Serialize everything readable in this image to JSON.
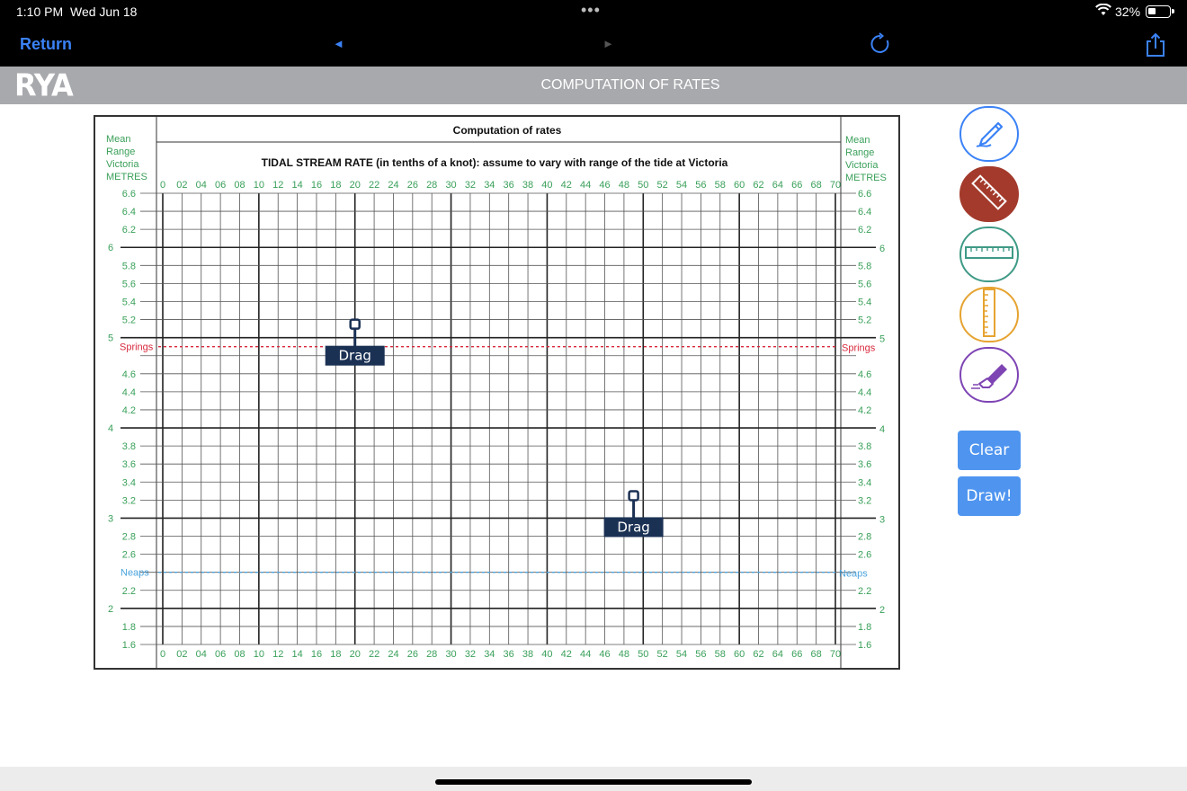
{
  "status_bar": {
    "time": "1:10 PM",
    "date": "Wed Jun 18",
    "multitask_dots": "•••",
    "battery_percent": "32%",
    "battery_level": 0.32
  },
  "nav": {
    "return_label": "Return",
    "back_arrow": "◄",
    "forward_arrow": "►",
    "reload_icon": "reload-icon",
    "share_icon": "share-icon"
  },
  "header": {
    "logo": "RYA",
    "title": "COMPUTATION OF RATES"
  },
  "chart": {
    "title": "Computation of rates",
    "subtitle": "TIDAL STREAM RATE (in tenths of a knot): assume to vary with range of the tide at Victoria",
    "side_label_lines": [
      "Mean",
      "Range",
      "Victoria",
      "METRES"
    ],
    "x_ticks": [
      "0",
      "02",
      "04",
      "06",
      "08",
      "10",
      "12",
      "14",
      "16",
      "18",
      "20",
      "22",
      "24",
      "26",
      "28",
      "30",
      "32",
      "34",
      "36",
      "38",
      "40",
      "42",
      "44",
      "46",
      "48",
      "50",
      "52",
      "54",
      "56",
      "58",
      "60",
      "62",
      "64",
      "66",
      "68",
      "70"
    ],
    "y_ticks": [
      "6.6",
      "6.4",
      "6.2",
      "6",
      "5.8",
      "5.6",
      "5.4",
      "5.2",
      "5",
      "4.8",
      "4.6",
      "4.4",
      "4.2",
      "4",
      "3.8",
      "3.6",
      "3.4",
      "3.2",
      "3",
      "2.8",
      "2.6",
      "2.4",
      "2.2",
      "2",
      "1.8",
      "1.6"
    ],
    "y_integer_ticks": [
      "6",
      "5",
      "4",
      "3",
      "2"
    ],
    "springs_label": "Springs",
    "springs_value": 4.9,
    "neaps_label": "Neaps",
    "neaps_value": 2.4,
    "springs_color": "#d8283c",
    "neaps_color": "#4aa3dd",
    "tick_color": "#3aa05a",
    "handles": [
      {
        "label": "Drag",
        "x_value": 20,
        "y_value": 4.9
      },
      {
        "label": "Drag",
        "x_value": 49,
        "y_value": 3.0
      }
    ]
  },
  "tools": {
    "pencil_icon": "pencil-icon",
    "ruler_icon": "diagonal-ruler-icon",
    "horizontal_ruler_icon": "horizontal-ruler-icon",
    "vertical_ruler_icon": "vertical-ruler-icon",
    "eraser_icon": "eraser-icon",
    "colors": {
      "pencil": "#3b82f6",
      "ruler": "#a33a2c",
      "hruler": "#3f9a86",
      "vruler": "#e6a330",
      "eraser": "#7e44b4"
    }
  },
  "buttons": {
    "clear_label": "Clear",
    "draw_label": "Draw!"
  }
}
